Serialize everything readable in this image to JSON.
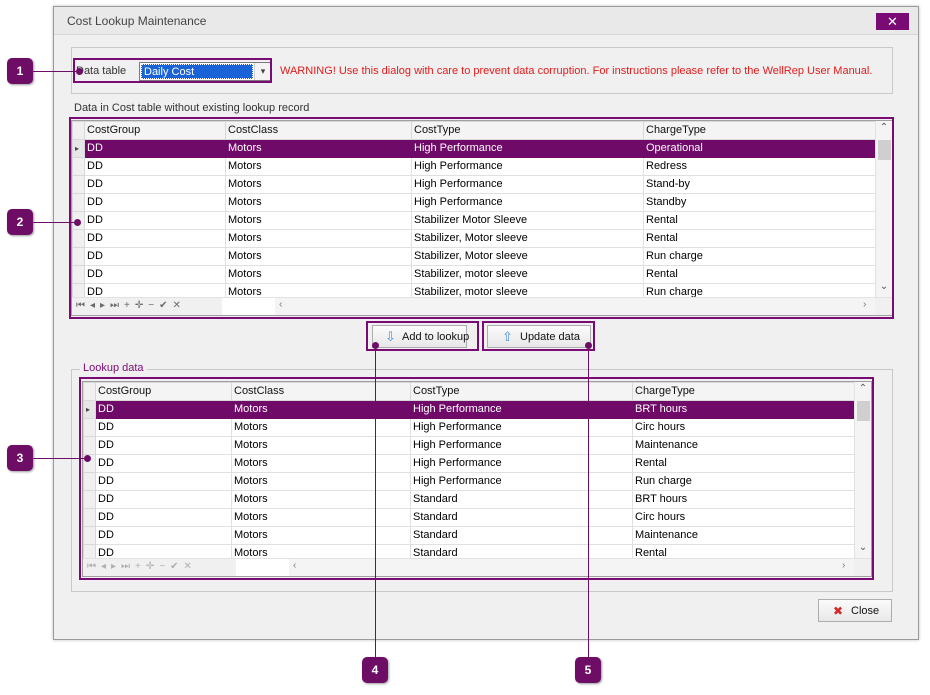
{
  "window": {
    "title": "Cost Lookup Maintenance",
    "close_glyph": "✕"
  },
  "data_table": {
    "label": "Data table",
    "selected": "Daily Cost",
    "arrow_glyph": "▾"
  },
  "warning": "WARNING!  Use this dialog with care to prevent data corruption.  For instructions please refer to the WellRep User Manual.",
  "top_grid": {
    "caption": "Data in Cost table without existing lookup record",
    "columns": [
      "CostGroup",
      "CostClass",
      "CostType",
      "ChargeType"
    ],
    "rows": [
      [
        "DD",
        "Motors",
        "High Performance",
        "Operational"
      ],
      [
        "DD",
        "Motors",
        "High Performance",
        "Redress"
      ],
      [
        "DD",
        "Motors",
        "High Performance",
        "Stand-by"
      ],
      [
        "DD",
        "Motors",
        "High Performance",
        "Standby"
      ],
      [
        "DD",
        "Motors",
        "Stabilizer Motor Sleeve",
        "Rental"
      ],
      [
        "DD",
        "Motors",
        "Stabilizer, Motor sleeve",
        "Rental"
      ],
      [
        "DD",
        "Motors",
        "Stabilizer, Motor sleeve",
        "Run charge"
      ],
      [
        "DD",
        "Motors",
        "Stabilizer, motor sleeve",
        "Rental"
      ],
      [
        "DD",
        "Motors",
        "Stabilizer, motor sleeve",
        "Run charge"
      ]
    ],
    "selected_row": 0,
    "nav_glyphs": "⏮◂▸⏭+✛−✔✕"
  },
  "buttons": {
    "add_to_lookup": "Add to lookup",
    "update_data": "Update data",
    "close": "Close",
    "add_icon": "⇩",
    "update_icon": "⇧",
    "close_icon": "✖"
  },
  "lookup_grid": {
    "caption": "Lookup data",
    "columns": [
      "CostGroup",
      "CostClass",
      "CostType",
      "ChargeType"
    ],
    "rows": [
      [
        "DD",
        "Motors",
        "High Performance",
        "BRT hours"
      ],
      [
        "DD",
        "Motors",
        "High Performance",
        "Circ hours"
      ],
      [
        "DD",
        "Motors",
        "High Performance",
        "Maintenance"
      ],
      [
        "DD",
        "Motors",
        "High Performance",
        "Rental"
      ],
      [
        "DD",
        "Motors",
        "High Performance",
        "Run charge"
      ],
      [
        "DD",
        "Motors",
        "Standard",
        "BRT hours"
      ],
      [
        "DD",
        "Motors",
        "Standard",
        "Circ hours"
      ],
      [
        "DD",
        "Motors",
        "Standard",
        "Maintenance"
      ],
      [
        "DD",
        "Motors",
        "Standard",
        "Rental"
      ]
    ],
    "selected_row": 0,
    "nav_glyphs": "⏮◂▸⏭+✛−✔✕"
  },
  "callouts": [
    "1",
    "2",
    "3",
    "4",
    "5"
  ],
  "colors": {
    "accent": "#6f0a68",
    "warning": "#e31b1b",
    "select_blue": "#1a63d6"
  }
}
